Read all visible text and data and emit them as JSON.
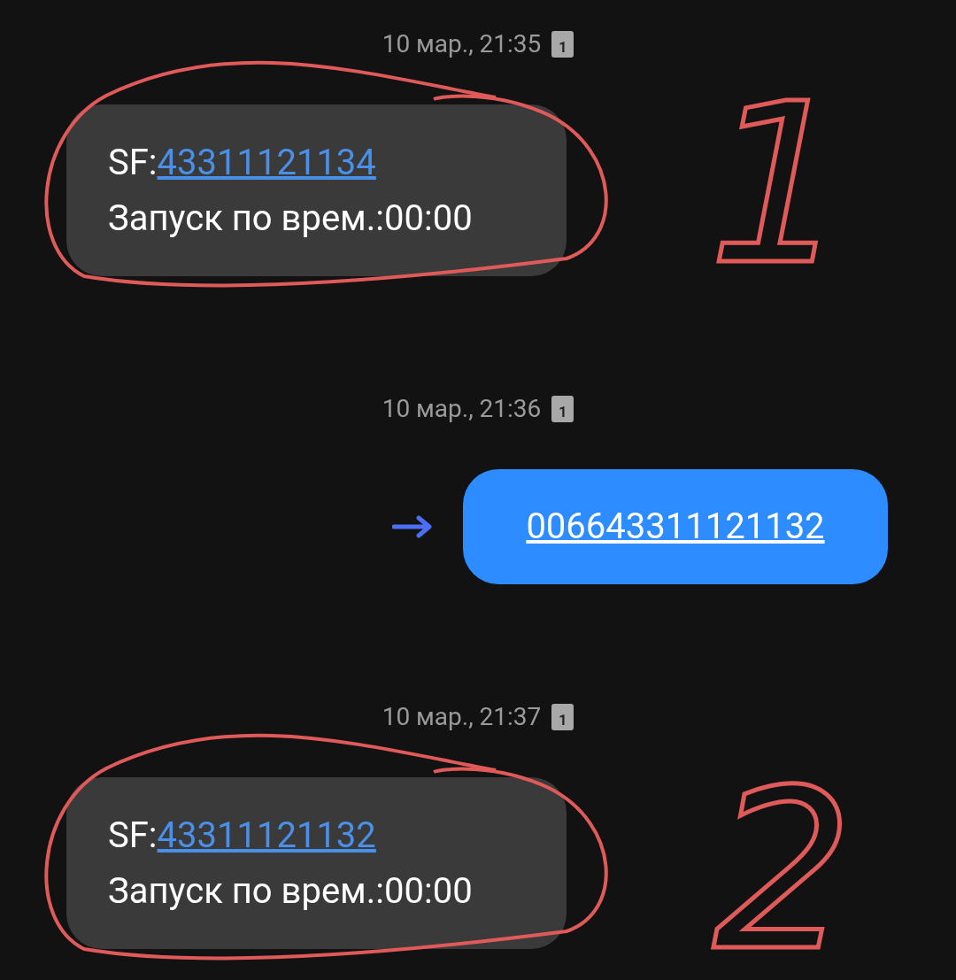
{
  "messages": [
    {
      "kind": "incoming",
      "timestamp": "10 мар., 21:35",
      "sim": "1",
      "prefix": "SF:",
      "number": "43311121134",
      "body": "Запуск по врем.:00:00"
    },
    {
      "kind": "outgoing",
      "timestamp": "10 мар., 21:36",
      "sim": "1",
      "number": "006643311121132"
    },
    {
      "kind": "incoming",
      "timestamp": "10 мар., 21:37",
      "sim": "1",
      "prefix": "SF:",
      "number": "43311121132",
      "body": "Запуск по врем.:00:00"
    }
  ],
  "annotations": [
    {
      "label": "1"
    },
    {
      "label": "2"
    }
  ]
}
